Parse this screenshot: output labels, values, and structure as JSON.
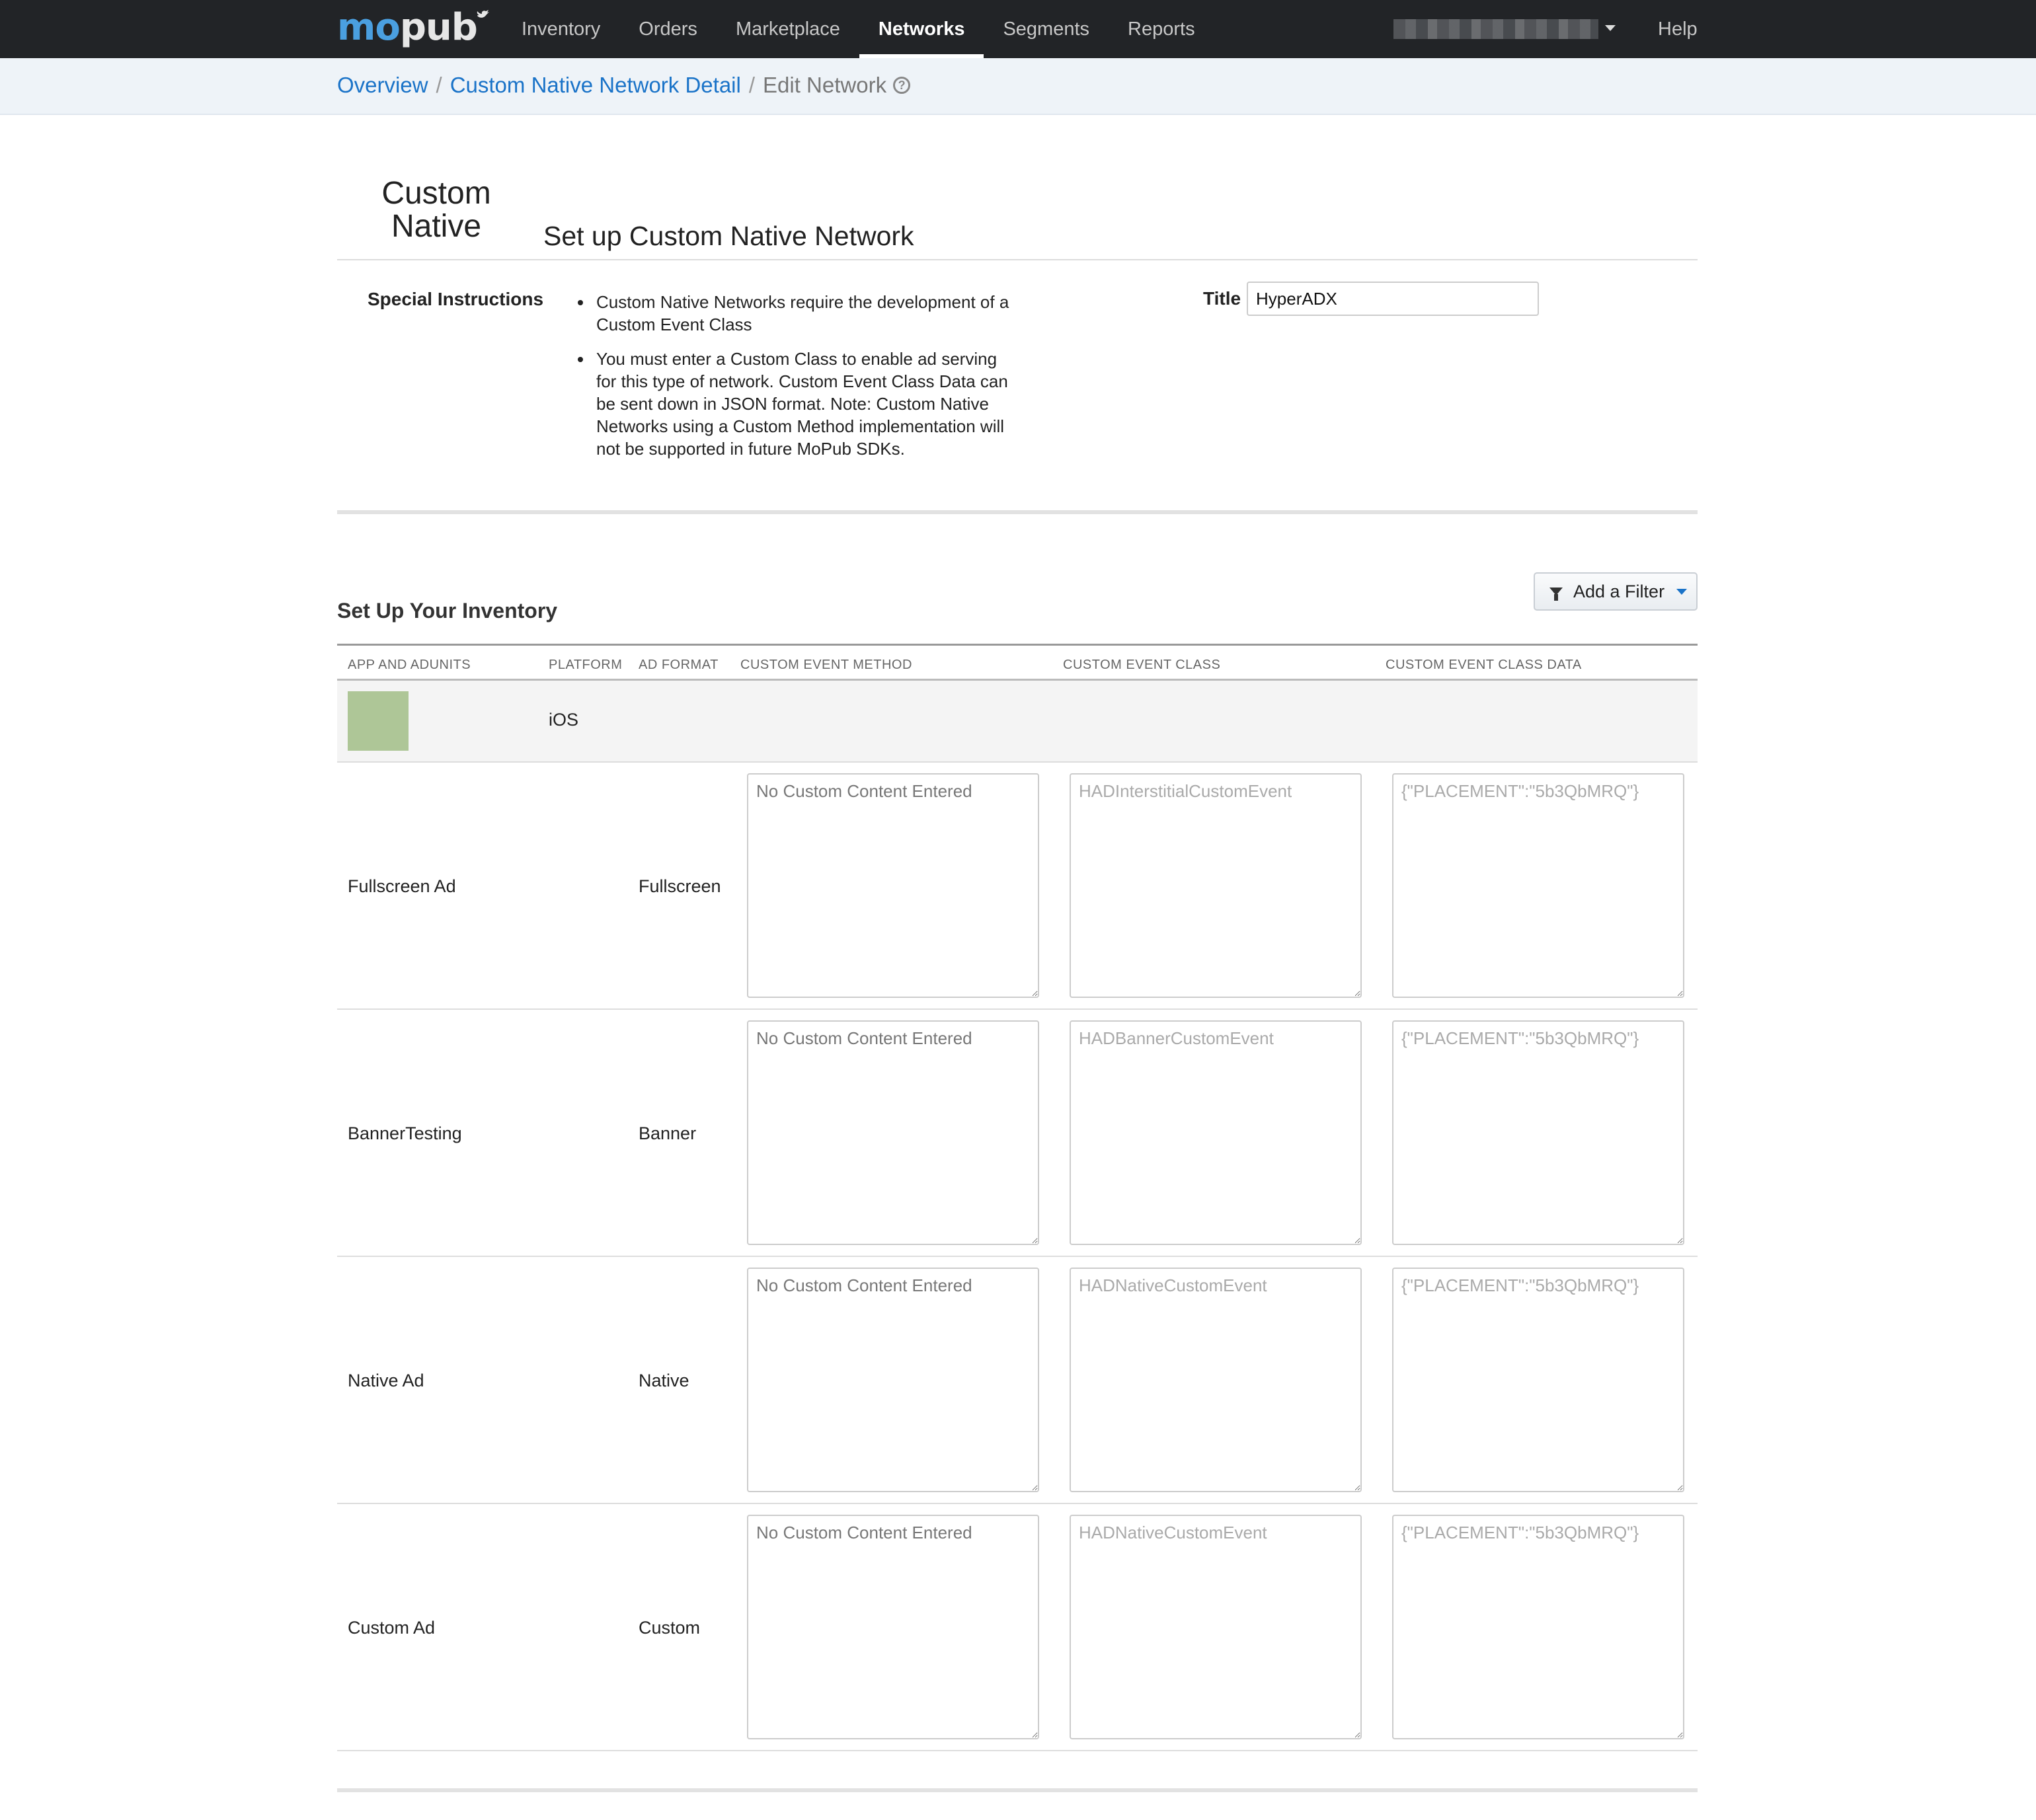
{
  "nav": {
    "logo_mo": "mo",
    "logo_pub": "pub",
    "items": [
      {
        "label": "Inventory"
      },
      {
        "label": "Orders"
      },
      {
        "label": "Marketplace"
      },
      {
        "label": "Networks",
        "active": true
      },
      {
        "label": "Segments"
      },
      {
        "label": "Reports"
      }
    ],
    "help": "Help"
  },
  "breadcrumb": {
    "overview": "Overview",
    "detail": "Custom Native Network Detail",
    "current": "Edit Network",
    "sep": "/"
  },
  "header": {
    "brand_line1": "Custom",
    "brand_line2": "Native",
    "title": "Set up Custom Native Network"
  },
  "special": {
    "label": "Special Instructions",
    "items": [
      "Custom Native Networks require the development of a Custom Event Class",
      "You must enter a Custom Class to enable ad serving for this type of network. Custom Event Class Data can be sent down in JSON format. Note: Custom Native Networks using a Custom Method implementation will not be supported in future MoPub SDKs."
    ]
  },
  "title_field": {
    "label": "Title",
    "value": "HyperADX"
  },
  "inventory": {
    "title": "Set Up Your Inventory",
    "filter_label": "Add a Filter",
    "columns": [
      "APP AND ADUNITS",
      "PLATFORM",
      "AD FORMAT",
      "CUSTOM EVENT METHOD",
      "CUSTOM EVENT CLASS",
      "CUSTOM EVENT CLASS DATA"
    ],
    "app": {
      "platform": "iOS",
      "icon_color": "#aec697"
    },
    "rows": [
      {
        "name": "Fullscreen Ad",
        "format": "Fullscreen",
        "method_placeholder": "No Custom Content Entered",
        "class_placeholder": "HADInterstitialCustomEvent",
        "data_placeholder": "{\"PLACEMENT\":\"5b3QbMRQ\"}"
      },
      {
        "name": "BannerTesting",
        "format": "Banner",
        "method_placeholder": "No Custom Content Entered",
        "class_placeholder": "HADBannerCustomEvent",
        "data_placeholder": "{\"PLACEMENT\":\"5b3QbMRQ\"}"
      },
      {
        "name": "Native Ad",
        "format": "Native",
        "method_placeholder": "No Custom Content Entered",
        "class_placeholder": "HADNativeCustomEvent",
        "data_placeholder": "{\"PLACEMENT\":\"5b3QbMRQ\"}"
      },
      {
        "name": "Custom Ad",
        "format": "Custom",
        "method_placeholder": "No Custom Content Entered",
        "class_placeholder": "HADNativeCustomEvent",
        "data_placeholder": "{\"PLACEMENT\":\"5b3QbMRQ\"}"
      }
    ]
  },
  "colors": {
    "nav_bg": "#222427",
    "link": "#1a73c8",
    "logo_blue": "#4a9fe0"
  }
}
